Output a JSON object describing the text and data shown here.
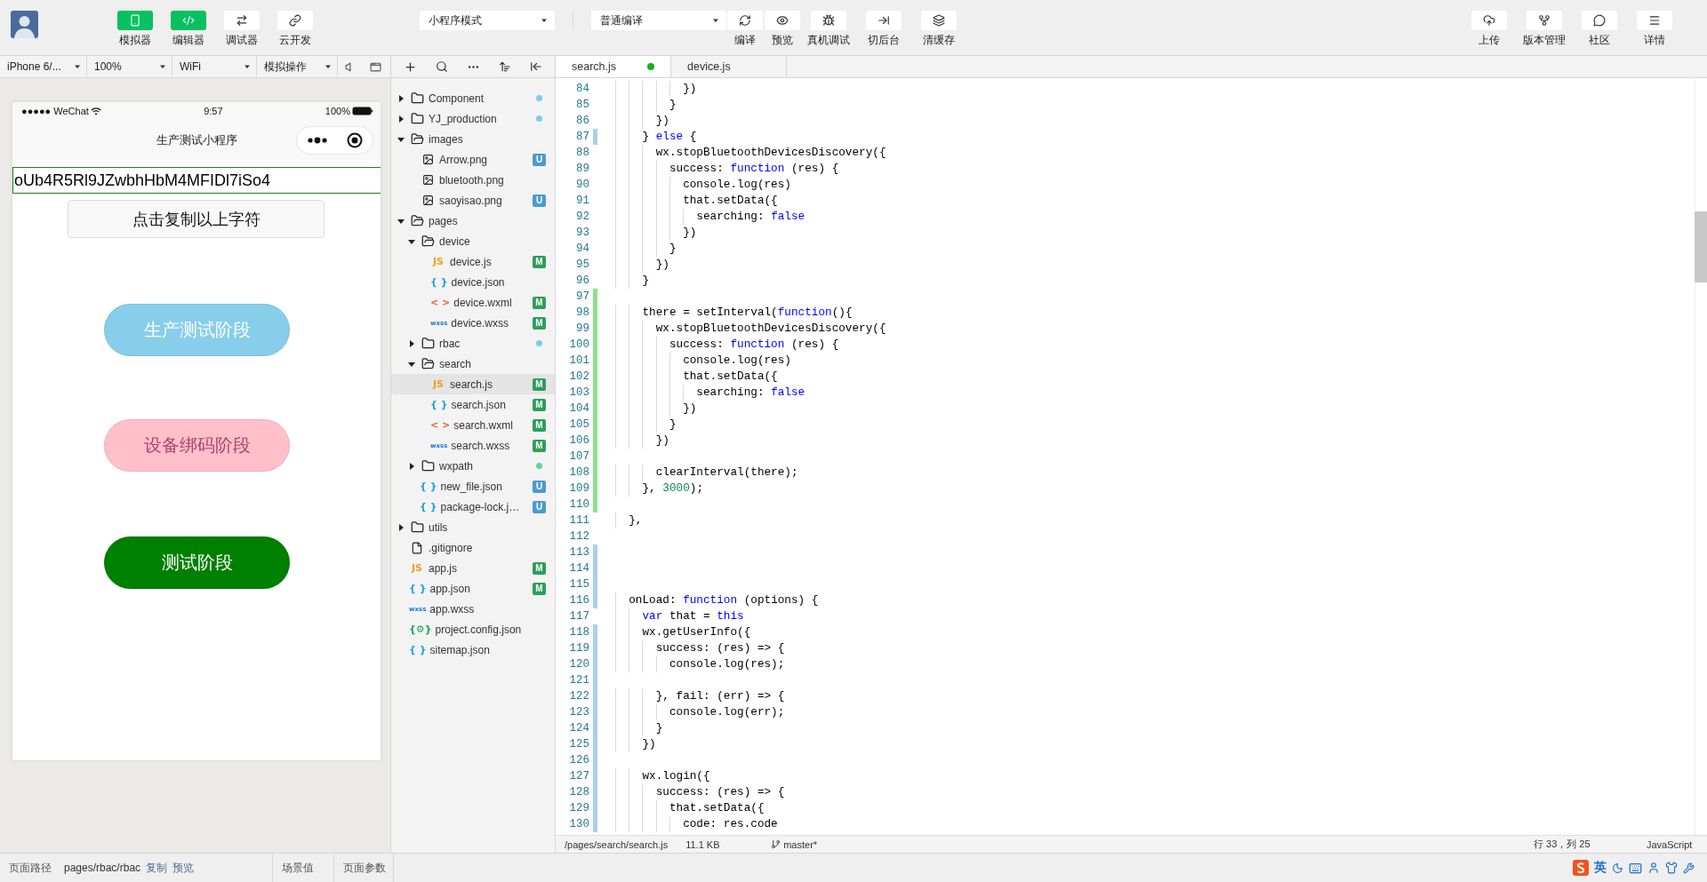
{
  "toolbar": {
    "mode_buttons": [
      {
        "label": "模拟器",
        "selected": true
      },
      {
        "label": "编辑器",
        "selected": true
      },
      {
        "label": "调试器",
        "selected": false
      },
      {
        "label": "云开发",
        "selected": false
      }
    ],
    "mode_select": "小程序模式",
    "compile_select": "普通编译",
    "actions": [
      {
        "label": "编译"
      },
      {
        "label": "预览"
      },
      {
        "label": "真机调试"
      },
      {
        "label": "切后台"
      },
      {
        "label": "清缓存"
      }
    ],
    "right_actions": [
      {
        "label": "上传"
      },
      {
        "label": "版本管理"
      },
      {
        "label": "社区"
      },
      {
        "label": "详情"
      }
    ]
  },
  "simulator": {
    "selects": [
      "iPhone 6/...",
      "100%",
      "WiFi",
      "模拟操作"
    ],
    "phone": {
      "carrier": "●●●●● WeChat",
      "time": "9:57",
      "battery": "100%",
      "title": "生产测试小程序",
      "input_value": "oUb4R5Rl9JZwbhHbM4MFIDl7iSo4",
      "copy_button": "点击复制以上字符",
      "buttons": [
        {
          "label": "生产测试阶段",
          "color": "#87ceeb"
        },
        {
          "label": "设备绑码阶段",
          "color": "#ffc0cb"
        },
        {
          "label": "测试阶段",
          "color": "#008000"
        }
      ]
    }
  },
  "tree": [
    {
      "name": "Component",
      "kind": "folder",
      "expanded": false,
      "selected": false,
      "color": "#7ecbf0"
    },
    {
      "name": "YJ_production",
      "kind": "folder",
      "expanded": false,
      "selected": false,
      "color": "#7ecbf0"
    },
    {
      "name": "images",
      "kind": "folder",
      "expanded": true,
      "selected": false,
      "children": [
        {
          "name": "Arrow.png",
          "kind": "image",
          "selected": false,
          "badge": {
            "text": "U",
            "kind": "untracked"
          }
        },
        {
          "name": "bluetooth.png",
          "kind": "image",
          "selected": false
        },
        {
          "name": "saoyisao.png",
          "kind": "image",
          "selected": false,
          "badge": {
            "text": "U",
            "kind": "untracked"
          }
        }
      ]
    },
    {
      "name": "pages",
      "kind": "folder",
      "expanded": true,
      "selected": false,
      "children": [
        {
          "name": "device",
          "kind": "folder",
          "expanded": true,
          "selected": false,
          "children": [
            {
              "name": "device.js",
              "kind": "js",
              "glyph": "JS",
              "selected": false,
              "badge": {
                "text": "M",
                "kind": "modified"
              }
            },
            {
              "name": "device.json",
              "kind": "json",
              "glyph": "{ }",
              "selected": false
            },
            {
              "name": "device.wxml",
              "kind": "wxml",
              "glyph": "< >",
              "selected": false,
              "badge": {
                "text": "M",
                "kind": "modified"
              }
            },
            {
              "name": "device.wxss",
              "kind": "wxss",
              "glyph": "wxss",
              "selected": false,
              "badge": {
                "text": "M",
                "kind": "modified"
              }
            }
          ]
        },
        {
          "name": "rbac",
          "kind": "folder",
          "expanded": false,
          "selected": false,
          "color": "#7ecbf0"
        },
        {
          "name": "search",
          "kind": "folder",
          "expanded": true,
          "selected": false,
          "children": [
            {
              "name": "search.js",
              "kind": "js",
              "glyph": "JS",
              "selected": true,
              "badge": {
                "text": "M",
                "kind": "modified"
              }
            },
            {
              "name": "search.json",
              "kind": "json",
              "glyph": "{ }",
              "selected": false,
              "badge": {
                "text": "M",
                "kind": "modified"
              }
            },
            {
              "name": "search.wxml",
              "kind": "wxml",
              "glyph": "< >",
              "selected": false,
              "badge": {
                "text": "M",
                "kind": "modified"
              }
            },
            {
              "name": "search.wxss",
              "kind": "wxss",
              "glyph": "wxss",
              "selected": false,
              "badge": {
                "text": "M",
                "kind": "modified"
              }
            }
          ]
        },
        {
          "name": "wxpath",
          "kind": "folder",
          "expanded": false,
          "selected": false,
          "color": "#5fd3a3"
        },
        {
          "name": "new_file.json",
          "kind": "json",
          "glyph": "{ }",
          "selected": false,
          "badge": {
            "text": "U",
            "kind": "untracked"
          }
        },
        {
          "name": "package-lock.j…",
          "kind": "json",
          "glyph": "{ }",
          "selected": false,
          "badge": {
            "text": "U",
            "kind": "untracked"
          }
        }
      ]
    },
    {
      "name": "utils",
      "kind": "folder",
      "expanded": false,
      "selected": false
    },
    {
      "name": ".gitignore",
      "kind": "file",
      "selected": false
    },
    {
      "name": "app.js",
      "kind": "js",
      "glyph": "JS",
      "selected": false,
      "badge": {
        "text": "M",
        "kind": "modified"
      }
    },
    {
      "name": "app.json",
      "kind": "json",
      "glyph": "{ }",
      "selected": false,
      "badge": {
        "text": "M",
        "kind": "modified"
      }
    },
    {
      "name": "app.wxss",
      "kind": "wxss",
      "glyph": "wxss",
      "selected": false
    },
    {
      "name": "project.config.json",
      "kind": "config",
      "glyph": "{⚙}",
      "selected": false
    },
    {
      "name": "sitemap.json",
      "kind": "json",
      "glyph": "{ }",
      "selected": false
    }
  ],
  "tabs": [
    {
      "label": "search.js",
      "selected": true,
      "unsaved": true
    },
    {
      "label": "device.js",
      "selected": false,
      "unsaved": false
    }
  ],
  "code_lines": [
    {
      "number": "84",
      "added": false,
      "modified": false,
      "tokens": [
        {
          "text": "          })",
          "kind": "plain"
        }
      ]
    },
    {
      "number": "85",
      "added": false,
      "modified": false,
      "tokens": [
        {
          "text": "        }",
          "kind": "plain"
        }
      ]
    },
    {
      "number": "86",
      "added": false,
      "modified": false,
      "tokens": [
        {
          "text": "      })",
          "kind": "plain"
        }
      ]
    },
    {
      "number": "87",
      "added": false,
      "modified": true,
      "tokens": [
        {
          "text": "    } ",
          "kind": "plain"
        },
        {
          "text": "else",
          "kind": "keyword"
        },
        {
          "text": " {",
          "kind": "plain"
        }
      ]
    },
    {
      "number": "88",
      "added": false,
      "modified": false,
      "tokens": [
        {
          "text": "      wx.stopBluetoothDevicesDiscovery({",
          "kind": "plain"
        }
      ]
    },
    {
      "number": "89",
      "added": false,
      "modified": false,
      "tokens": [
        {
          "text": "        success: ",
          "kind": "plain"
        },
        {
          "text": "function",
          "kind": "keyword"
        },
        {
          "text": " (res) {",
          "kind": "plain"
        }
      ]
    },
    {
      "number": "90",
      "added": false,
      "modified": false,
      "tokens": [
        {
          "text": "          console.log(res)",
          "kind": "plain"
        }
      ]
    },
    {
      "number": "91",
      "added": false,
      "modified": false,
      "tokens": [
        {
          "text": "          that.setData({",
          "kind": "plain"
        }
      ]
    },
    {
      "number": "92",
      "added": false,
      "modified": false,
      "tokens": [
        {
          "text": "            searching: ",
          "kind": "plain"
        },
        {
          "text": "false",
          "kind": "keyword"
        }
      ]
    },
    {
      "number": "93",
      "added": false,
      "modified": false,
      "tokens": [
        {
          "text": "          })",
          "kind": "plain"
        }
      ]
    },
    {
      "number": "94",
      "added": false,
      "modified": false,
      "tokens": [
        {
          "text": "        }",
          "kind": "plain"
        }
      ]
    },
    {
      "number": "95",
      "added": false,
      "modified": false,
      "tokens": [
        {
          "text": "      })",
          "kind": "plain"
        }
      ]
    },
    {
      "number": "96",
      "added": false,
      "modified": false,
      "tokens": [
        {
          "text": "    }",
          "kind": "plain"
        }
      ]
    },
    {
      "number": "97",
      "added": true,
      "modified": false
    },
    {
      "number": "98",
      "added": true,
      "modified": false,
      "tokens": [
        {
          "text": "    there = setInterval(",
          "kind": "plain"
        },
        {
          "text": "function",
          "kind": "keyword"
        },
        {
          "text": "(){",
          "kind": "plain"
        }
      ]
    },
    {
      "number": "99",
      "added": true,
      "modified": false,
      "tokens": [
        {
          "text": "      wx.stopBluetoothDevicesDiscovery({",
          "kind": "plain"
        }
      ]
    },
    {
      "number": "100",
      "added": true,
      "modified": false,
      "tokens": [
        {
          "text": "        success: ",
          "kind": "plain"
        },
        {
          "text": "function",
          "kind": "keyword"
        },
        {
          "text": " (res) {",
          "kind": "plain"
        }
      ]
    },
    {
      "number": "101",
      "added": true,
      "modified": false,
      "tokens": [
        {
          "text": "          console.log(res)",
          "kind": "plain"
        }
      ]
    },
    {
      "number": "102",
      "added": true,
      "modified": false,
      "tokens": [
        {
          "text": "          that.setData({",
          "kind": "plain"
        }
      ]
    },
    {
      "number": "103",
      "added": true,
      "modified": false,
      "tokens": [
        {
          "text": "            searching: ",
          "kind": "plain"
        },
        {
          "text": "false",
          "kind": "keyword"
        }
      ]
    },
    {
      "number": "104",
      "added": true,
      "modified": false,
      "tokens": [
        {
          "text": "          })",
          "kind": "plain"
        }
      ]
    },
    {
      "number": "105",
      "added": true,
      "modified": false,
      "tokens": [
        {
          "text": "        }",
          "kind": "plain"
        }
      ]
    },
    {
      "number": "106",
      "added": true,
      "modified": false,
      "tokens": [
        {
          "text": "      })",
          "kind": "plain"
        }
      ]
    },
    {
      "number": "107",
      "added": true,
      "modified": false
    },
    {
      "number": "108",
      "added": true,
      "modified": false,
      "tokens": [
        {
          "text": "      clearInterval(there);",
          "kind": "plain"
        }
      ]
    },
    {
      "number": "109",
      "added": true,
      "modified": false,
      "tokens": [
        {
          "text": "    }, ",
          "kind": "plain"
        },
        {
          "text": "3000",
          "kind": "number"
        },
        {
          "text": ");",
          "kind": "plain"
        }
      ]
    },
    {
      "number": "110",
      "added": true,
      "modified": false
    },
    {
      "number": "111",
      "added": false,
      "modified": false,
      "tokens": [
        {
          "text": "  },",
          "kind": "plain"
        }
      ]
    },
    {
      "number": "112",
      "added": false,
      "modified": false
    },
    {
      "number": "113",
      "added": false,
      "modified": true
    },
    {
      "number": "114",
      "added": false,
      "modified": true
    },
    {
      "number": "115",
      "added": false,
      "modified": true
    },
    {
      "number": "116",
      "added": false,
      "modified": true,
      "tokens": [
        {
          "text": "  onLoad: ",
          "kind": "plain"
        },
        {
          "text": "function",
          "kind": "keyword"
        },
        {
          "text": " (options) {",
          "kind": "plain"
        }
      ]
    },
    {
      "number": "117",
      "added": false,
      "modified": false,
      "tokens": [
        {
          "text": "    var",
          "kind": "keyword"
        },
        {
          "text": " that = ",
          "kind": "plain"
        },
        {
          "text": "this",
          "kind": "keyword"
        }
      ]
    },
    {
      "number": "118",
      "added": false,
      "modified": true,
      "tokens": [
        {
          "text": "    wx.getUserInfo({",
          "kind": "plain"
        }
      ]
    },
    {
      "number": "119",
      "added": false,
      "modified": true,
      "tokens": [
        {
          "text": "      success: (res) => {",
          "kind": "plain"
        }
      ]
    },
    {
      "number": "120",
      "added": false,
      "modified": true,
      "tokens": [
        {
          "text": "        console.log(res);",
          "kind": "plain"
        }
      ]
    },
    {
      "number": "121",
      "added": false,
      "modified": true
    },
    {
      "number": "122",
      "added": false,
      "modified": true,
      "tokens": [
        {
          "text": "      }, fail: (err) => {",
          "kind": "plain"
        }
      ]
    },
    {
      "number": "123",
      "added": false,
      "modified": true,
      "tokens": [
        {
          "text": "        console.log(err);",
          "kind": "plain"
        }
      ]
    },
    {
      "number": "124",
      "added": false,
      "modified": true,
      "tokens": [
        {
          "text": "      }",
          "kind": "plain"
        }
      ]
    },
    {
      "number": "125",
      "added": false,
      "modified": true,
      "tokens": [
        {
          "text": "    })",
          "kind": "plain"
        }
      ]
    },
    {
      "number": "126",
      "added": false,
      "modified": true
    },
    {
      "number": "127",
      "added": false,
      "modified": true,
      "tokens": [
        {
          "text": "    wx.login({",
          "kind": "plain"
        }
      ]
    },
    {
      "number": "128",
      "added": false,
      "modified": true,
      "tokens": [
        {
          "text": "      success: (res) => {",
          "kind": "plain"
        }
      ]
    },
    {
      "number": "129",
      "added": false,
      "modified": true,
      "tokens": [
        {
          "text": "        that.setData({",
          "kind": "plain"
        }
      ]
    },
    {
      "number": "130",
      "added": false,
      "modified": true,
      "tokens": [
        {
          "text": "          code: res.code",
          "kind": "plain"
        }
      ]
    }
  ],
  "status_bar": {
    "path": "/pages/search/search.js",
    "size": "11.1 KB",
    "branch": "master*",
    "position": "行 33，列 25",
    "language": "JavaScript"
  },
  "bottom_bar": {
    "path_label": "页面路径",
    "path": "pages/rbac/rbac",
    "copy_link": "复制",
    "preview_link": "预览",
    "scene_label": "场景值",
    "params_label": "页面参数"
  },
  "tray": {
    "input_mode": "英"
  }
}
